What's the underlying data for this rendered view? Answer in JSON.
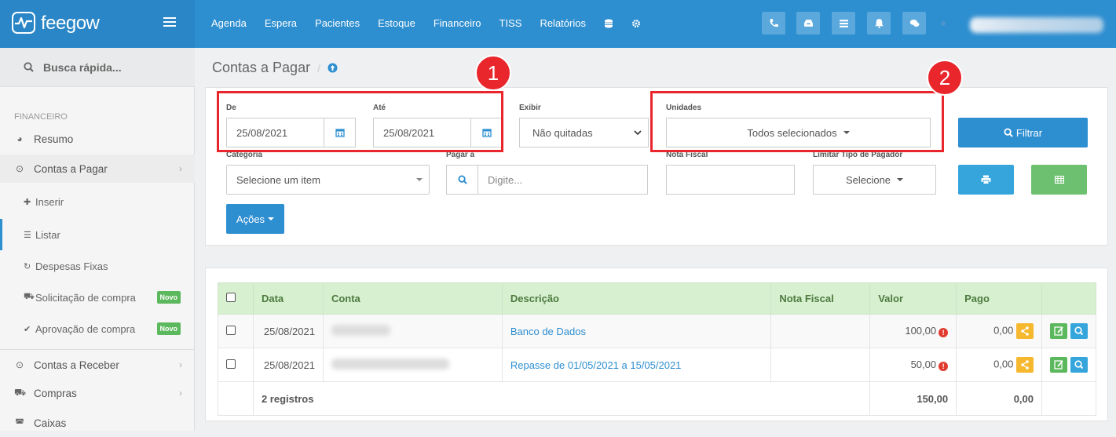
{
  "brand": {
    "name": "feegow"
  },
  "nav": [
    "Agenda",
    "Espera",
    "Pacientes",
    "Estoque",
    "Financeiro",
    "TISS",
    "Relatórios"
  ],
  "sidebar": {
    "search_label": "Busca rápida...",
    "section": "FINANCEIRO",
    "items": [
      {
        "label": "Resumo",
        "icon": "pie-chart-icon"
      },
      {
        "label": "Contas a Pagar",
        "icon": "arrow-up-circle-icon"
      },
      {
        "label": "Contas a Receber",
        "icon": "arrow-down-circle-icon"
      },
      {
        "label": "Compras",
        "icon": "cart-icon"
      },
      {
        "label": "Caixas",
        "icon": "inbox-icon"
      }
    ],
    "subitems": [
      {
        "label": "Inserir",
        "icon": "plus-icon"
      },
      {
        "label": "Listar",
        "icon": "list-icon"
      },
      {
        "label": "Despesas Fixas",
        "icon": "refresh-icon"
      },
      {
        "label": "Solicitação de compra",
        "icon": "cart-icon",
        "badge": "Novo"
      },
      {
        "label": "Aprovação de compra",
        "icon": "check-icon",
        "badge": "Novo"
      }
    ]
  },
  "page": {
    "title": "Contas a Pagar"
  },
  "filters": {
    "de_label": "De",
    "de_value": "25/08/2021",
    "ate_label": "Até",
    "ate_value": "25/08/2021",
    "exibir_label": "Exibir",
    "exibir_value": "Não quitadas",
    "unidades_label": "Unidades",
    "unidades_value": "Todos selecionados",
    "filtrar_label": "Filtrar",
    "categoria_label": "Categoria",
    "categoria_value": "Selecione um item",
    "pagar_a_label": "Pagar a",
    "pagar_a_placeholder": "Digite...",
    "nota_fiscal_label": "Nota Fiscal",
    "limitar_label": "Limitar Tipo de Pagador",
    "limitar_value": "Selecione",
    "acoes_label": "Ações"
  },
  "annotations": [
    "1",
    "2"
  ],
  "table": {
    "headers": [
      "Data",
      "Conta",
      "Descrição",
      "Nota Fiscal",
      "Valor",
      "Pago"
    ],
    "rows": [
      {
        "data": "25/08/2021",
        "descricao": "Banco de Dados",
        "valor": "100,00",
        "pago": "0,00"
      },
      {
        "data": "25/08/2021",
        "descricao": "Repasse de 01/05/2021 a 15/05/2021",
        "valor": "50,00",
        "pago": "0,00"
      }
    ],
    "footer": {
      "registros": "2 registros",
      "valor_total": "150,00",
      "pago_total": "0,00"
    }
  },
  "colors": {
    "brand": "#2d8ed0",
    "highlight": "#e8262c",
    "success": "#5cb85c",
    "warning": "#f0ad4e"
  }
}
